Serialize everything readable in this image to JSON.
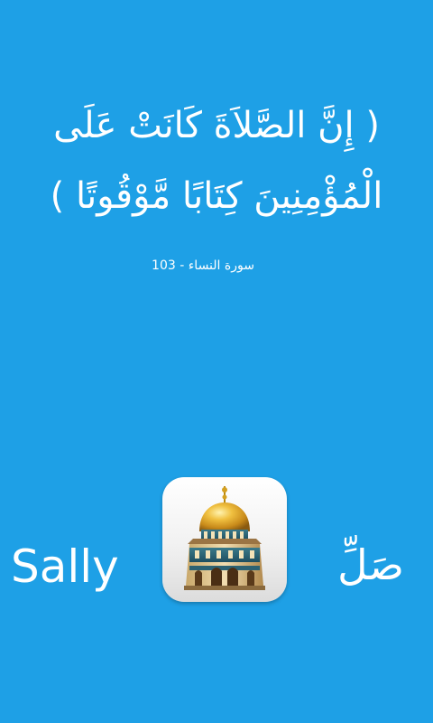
{
  "verse": {
    "line1": "( إِنَّ الصَّلاَةَ كَانَتْ عَلَى",
    "line2": "الْمُؤْمِنِينَ كِتَابًا مَّوْقُوتًا )"
  },
  "reference": "سورة النساء - 103",
  "app": {
    "name_en": "Sally",
    "name_ar": "صَلِّ",
    "icon": "mosque-dome-icon"
  },
  "colors": {
    "background": "#1ea0e6",
    "text": "#ffffff",
    "dome": "#e0a82a"
  }
}
